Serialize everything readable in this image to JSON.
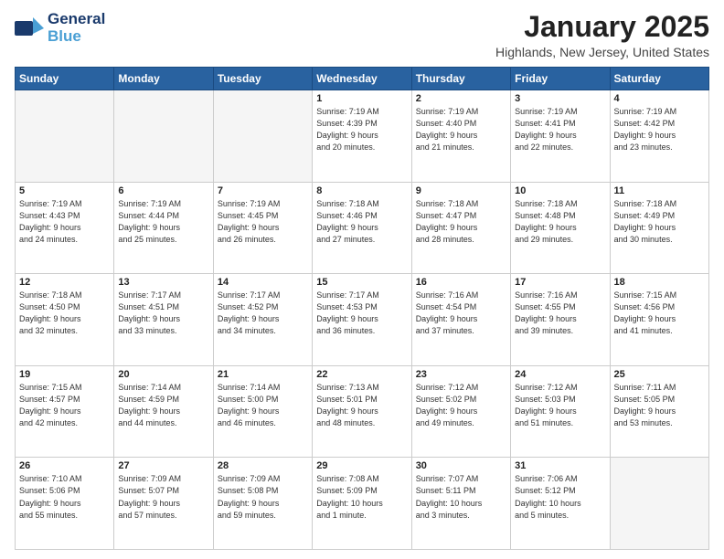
{
  "header": {
    "logo_line1": "General",
    "logo_line2": "Blue",
    "month": "January 2025",
    "location": "Highlands, New Jersey, United States"
  },
  "weekdays": [
    "Sunday",
    "Monday",
    "Tuesday",
    "Wednesday",
    "Thursday",
    "Friday",
    "Saturday"
  ],
  "weeks": [
    [
      {
        "day": "",
        "info": ""
      },
      {
        "day": "",
        "info": ""
      },
      {
        "day": "",
        "info": ""
      },
      {
        "day": "1",
        "info": "Sunrise: 7:19 AM\nSunset: 4:39 PM\nDaylight: 9 hours\nand 20 minutes."
      },
      {
        "day": "2",
        "info": "Sunrise: 7:19 AM\nSunset: 4:40 PM\nDaylight: 9 hours\nand 21 minutes."
      },
      {
        "day": "3",
        "info": "Sunrise: 7:19 AM\nSunset: 4:41 PM\nDaylight: 9 hours\nand 22 minutes."
      },
      {
        "day": "4",
        "info": "Sunrise: 7:19 AM\nSunset: 4:42 PM\nDaylight: 9 hours\nand 23 minutes."
      }
    ],
    [
      {
        "day": "5",
        "info": "Sunrise: 7:19 AM\nSunset: 4:43 PM\nDaylight: 9 hours\nand 24 minutes."
      },
      {
        "day": "6",
        "info": "Sunrise: 7:19 AM\nSunset: 4:44 PM\nDaylight: 9 hours\nand 25 minutes."
      },
      {
        "day": "7",
        "info": "Sunrise: 7:19 AM\nSunset: 4:45 PM\nDaylight: 9 hours\nand 26 minutes."
      },
      {
        "day": "8",
        "info": "Sunrise: 7:18 AM\nSunset: 4:46 PM\nDaylight: 9 hours\nand 27 minutes."
      },
      {
        "day": "9",
        "info": "Sunrise: 7:18 AM\nSunset: 4:47 PM\nDaylight: 9 hours\nand 28 minutes."
      },
      {
        "day": "10",
        "info": "Sunrise: 7:18 AM\nSunset: 4:48 PM\nDaylight: 9 hours\nand 29 minutes."
      },
      {
        "day": "11",
        "info": "Sunrise: 7:18 AM\nSunset: 4:49 PM\nDaylight: 9 hours\nand 30 minutes."
      }
    ],
    [
      {
        "day": "12",
        "info": "Sunrise: 7:18 AM\nSunset: 4:50 PM\nDaylight: 9 hours\nand 32 minutes."
      },
      {
        "day": "13",
        "info": "Sunrise: 7:17 AM\nSunset: 4:51 PM\nDaylight: 9 hours\nand 33 minutes."
      },
      {
        "day": "14",
        "info": "Sunrise: 7:17 AM\nSunset: 4:52 PM\nDaylight: 9 hours\nand 34 minutes."
      },
      {
        "day": "15",
        "info": "Sunrise: 7:17 AM\nSunset: 4:53 PM\nDaylight: 9 hours\nand 36 minutes."
      },
      {
        "day": "16",
        "info": "Sunrise: 7:16 AM\nSunset: 4:54 PM\nDaylight: 9 hours\nand 37 minutes."
      },
      {
        "day": "17",
        "info": "Sunrise: 7:16 AM\nSunset: 4:55 PM\nDaylight: 9 hours\nand 39 minutes."
      },
      {
        "day": "18",
        "info": "Sunrise: 7:15 AM\nSunset: 4:56 PM\nDaylight: 9 hours\nand 41 minutes."
      }
    ],
    [
      {
        "day": "19",
        "info": "Sunrise: 7:15 AM\nSunset: 4:57 PM\nDaylight: 9 hours\nand 42 minutes."
      },
      {
        "day": "20",
        "info": "Sunrise: 7:14 AM\nSunset: 4:59 PM\nDaylight: 9 hours\nand 44 minutes."
      },
      {
        "day": "21",
        "info": "Sunrise: 7:14 AM\nSunset: 5:00 PM\nDaylight: 9 hours\nand 46 minutes."
      },
      {
        "day": "22",
        "info": "Sunrise: 7:13 AM\nSunset: 5:01 PM\nDaylight: 9 hours\nand 48 minutes."
      },
      {
        "day": "23",
        "info": "Sunrise: 7:12 AM\nSunset: 5:02 PM\nDaylight: 9 hours\nand 49 minutes."
      },
      {
        "day": "24",
        "info": "Sunrise: 7:12 AM\nSunset: 5:03 PM\nDaylight: 9 hours\nand 51 minutes."
      },
      {
        "day": "25",
        "info": "Sunrise: 7:11 AM\nSunset: 5:05 PM\nDaylight: 9 hours\nand 53 minutes."
      }
    ],
    [
      {
        "day": "26",
        "info": "Sunrise: 7:10 AM\nSunset: 5:06 PM\nDaylight: 9 hours\nand 55 minutes."
      },
      {
        "day": "27",
        "info": "Sunrise: 7:09 AM\nSunset: 5:07 PM\nDaylight: 9 hours\nand 57 minutes."
      },
      {
        "day": "28",
        "info": "Sunrise: 7:09 AM\nSunset: 5:08 PM\nDaylight: 9 hours\nand 59 minutes."
      },
      {
        "day": "29",
        "info": "Sunrise: 7:08 AM\nSunset: 5:09 PM\nDaylight: 10 hours\nand 1 minute."
      },
      {
        "day": "30",
        "info": "Sunrise: 7:07 AM\nSunset: 5:11 PM\nDaylight: 10 hours\nand 3 minutes."
      },
      {
        "day": "31",
        "info": "Sunrise: 7:06 AM\nSunset: 5:12 PM\nDaylight: 10 hours\nand 5 minutes."
      },
      {
        "day": "",
        "info": ""
      }
    ]
  ]
}
